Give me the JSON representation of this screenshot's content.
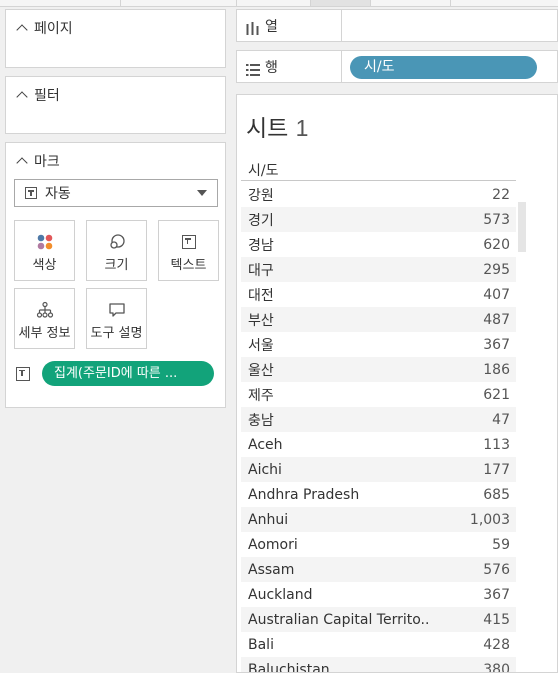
{
  "panels": {
    "pages": {
      "title": "페이지"
    },
    "filters": {
      "title": "필터"
    },
    "marks": {
      "title": "마크",
      "mark_type": "자동",
      "buttons": {
        "color": "색상",
        "size": "크기",
        "text": "텍스트",
        "detail": "세부 정보",
        "tooltip": "도구 설명"
      },
      "text_pill": "집계(주문ID에 따른 ..."
    }
  },
  "shelves": {
    "columns": {
      "label": "열"
    },
    "rows": {
      "label": "행",
      "pill": "시/도"
    }
  },
  "sheet": {
    "title_text": "시트",
    "title_num": "1",
    "column_header": "시/도",
    "rows": [
      {
        "name": "강원",
        "value": "22"
      },
      {
        "name": "경기",
        "value": "573"
      },
      {
        "name": "경남",
        "value": "620"
      },
      {
        "name": "대구",
        "value": "295"
      },
      {
        "name": "대전",
        "value": "407"
      },
      {
        "name": "부산",
        "value": "487"
      },
      {
        "name": "서울",
        "value": "367"
      },
      {
        "name": "울산",
        "value": "186"
      },
      {
        "name": "제주",
        "value": "621"
      },
      {
        "name": "충남",
        "value": "47"
      },
      {
        "name": "Aceh",
        "value": "113"
      },
      {
        "name": "Aichi",
        "value": "177"
      },
      {
        "name": "Andhra Pradesh",
        "value": "685"
      },
      {
        "name": "Anhui",
        "value": "1,003"
      },
      {
        "name": "Aomori",
        "value": "59"
      },
      {
        "name": "Assam",
        "value": "576"
      },
      {
        "name": "Auckland",
        "value": "367"
      },
      {
        "name": "Australian Capital Territo..",
        "value": "415"
      },
      {
        "name": "Bali",
        "value": "428"
      },
      {
        "name": "Baluchistan",
        "value": "380"
      }
    ]
  },
  "colors": {
    "row_pill": "#4a96b6",
    "text_pill": "#12a37a"
  }
}
